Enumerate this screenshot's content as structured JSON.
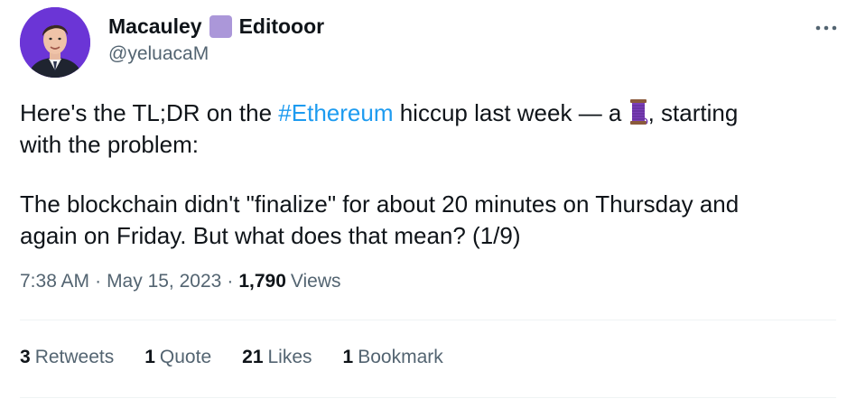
{
  "author": {
    "display_name": "Macauley",
    "display_name_suffix": "Editooor",
    "handle": "@yeluacaM",
    "badge_color": "#ab97d9",
    "avatar_bg": "#6b35d6"
  },
  "more_icon": "more-horizontal-icon",
  "tweet": {
    "line1_before": "Here's the TL;DR on the ",
    "hashtag": "#Ethereum",
    "line1_after": " hiccup last week — a ",
    "emoji": "thread-spool-emoji",
    "line1_end": ", starting",
    "line2": "with the problem:",
    "para2_line1": "The blockchain didn't \"finalize\" for about 20 minutes on Thursday and",
    "para2_line2": "again on Friday. But what does that mean? (1/9)"
  },
  "meta": {
    "time": "7:38 AM",
    "separator": "·",
    "date": "May 15, 2023",
    "views_count": "1,790",
    "views_label": "Views"
  },
  "stats": [
    {
      "count": "3",
      "label": "Retweets"
    },
    {
      "count": "1",
      "label": "Quote"
    },
    {
      "count": "21",
      "label": "Likes"
    },
    {
      "count": "1",
      "label": "Bookmark"
    }
  ],
  "colors": {
    "link": "#1d9bf0",
    "secondary_text": "#536471",
    "primary_text": "#0f1419"
  }
}
